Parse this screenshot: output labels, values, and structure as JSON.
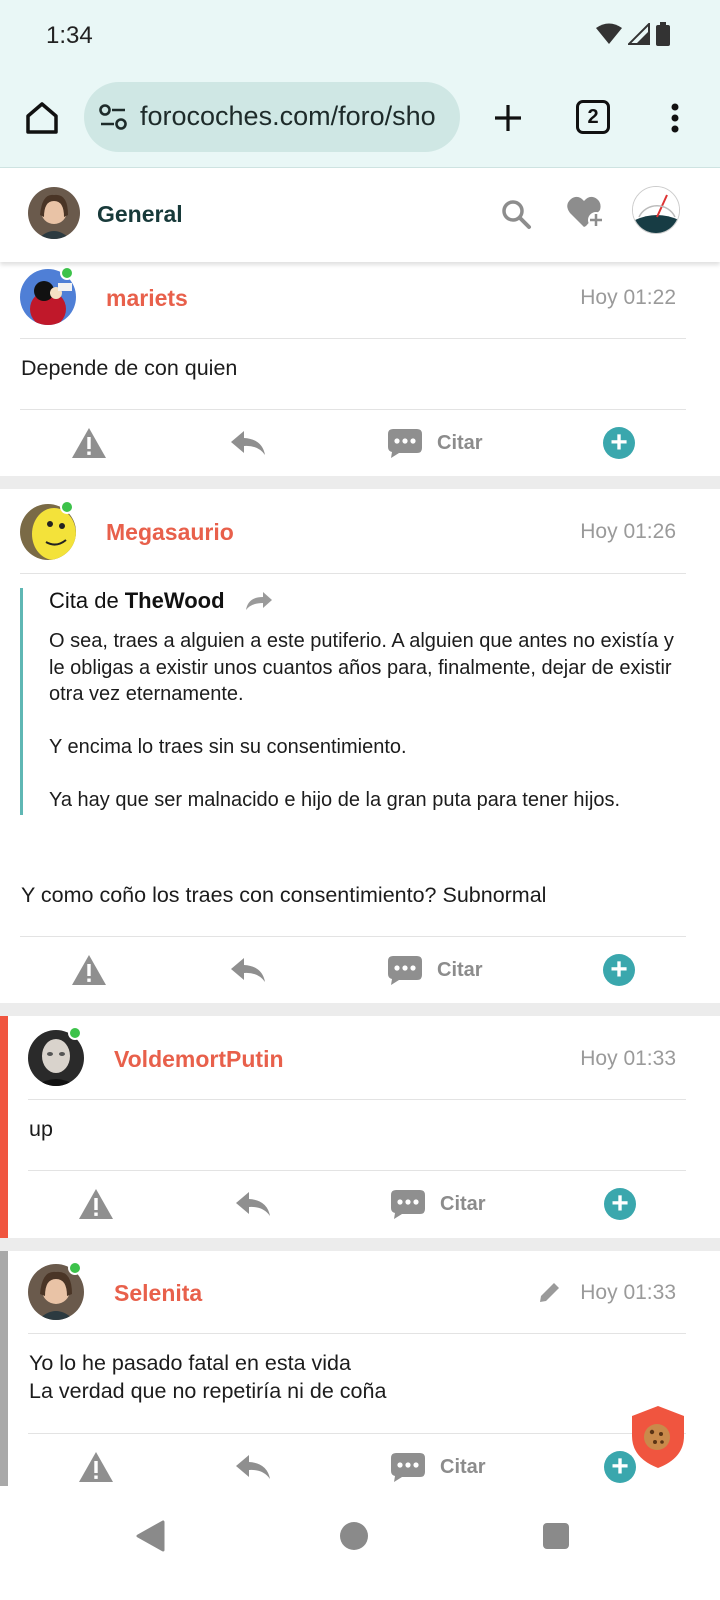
{
  "status_bar": {
    "time": "1:34"
  },
  "browser": {
    "url": "forocoches.com/foro/sho",
    "tab_count": "2"
  },
  "forum_header": {
    "title": "General"
  },
  "posts": [
    {
      "username": "mariets",
      "time": "Hoy 01:22",
      "online": true,
      "text": "Depende de con quien",
      "citar_label": "Citar"
    },
    {
      "username": "Megasaurio",
      "time": "Hoy 01:26",
      "online": true,
      "quote": {
        "prefix": "Cita de",
        "author": "TheWood",
        "text": "O sea, traes a alguien a este putiferio. A alguien que antes no existía y le obligas a existir unos cuantos años para, finalmente, dejar de existir otra vez eternamente.\n\nY encima lo traes sin su consentimiento.\n\nYa hay que ser malnacido e hijo de la gran puta para tener hijos."
      },
      "text": "Y como coño los traes con consentimiento? Subnormal",
      "citar_label": "Citar"
    },
    {
      "username": "VoldemortPutin",
      "time": "Hoy 01:33",
      "online": true,
      "text": "up",
      "citar_label": "Citar",
      "accent_color": "#f0553f"
    },
    {
      "username": "Selenita",
      "time": "Hoy 01:33",
      "online": true,
      "edited": true,
      "text_lines": [
        "Yo lo he pasado fatal en esta vida",
        "La verdad que no repetiría ni de coña"
      ],
      "citar_label": "Citar",
      "accent_color": "#a9a9a9"
    }
  ],
  "colors": {
    "username": "#e8604b",
    "accent_teal": "#3aa7ad",
    "online": "#3cc24a",
    "chrome_bg": "#e9f7f6"
  }
}
